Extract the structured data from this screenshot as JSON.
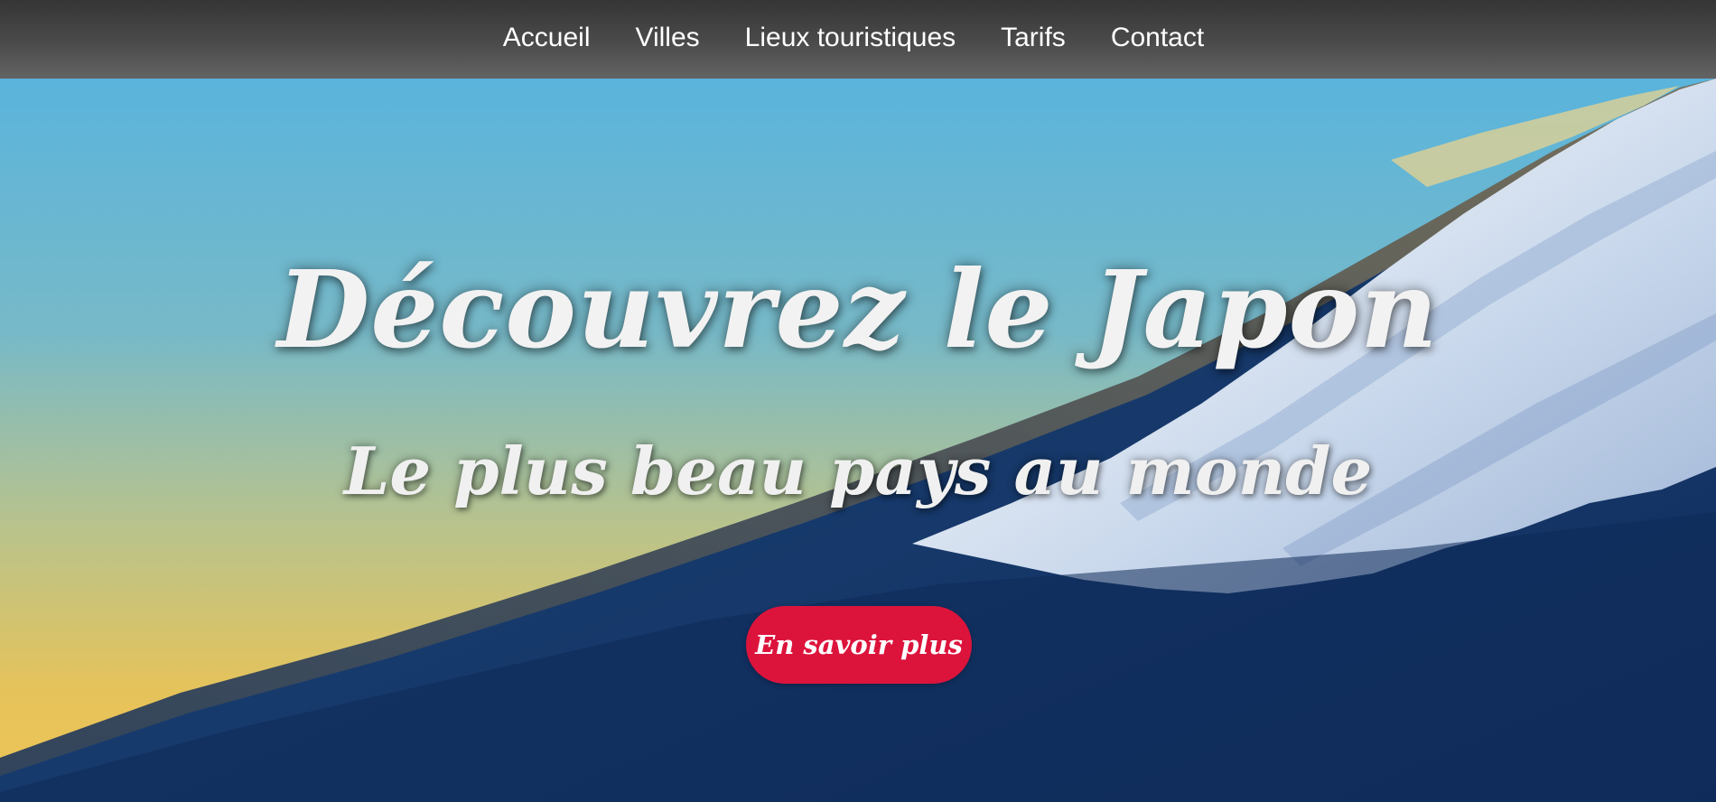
{
  "nav": {
    "items": [
      {
        "label": "Accueil"
      },
      {
        "label": "Villes"
      },
      {
        "label": "Lieux touristiques"
      },
      {
        "label": "Tarifs"
      },
      {
        "label": "Contact"
      }
    ]
  },
  "hero": {
    "title": "Découvrez le Japon",
    "subtitle": "Le plus beau pays au monde",
    "cta_label": "En savoir plus",
    "background_image": "mount-fuji-sunset"
  },
  "colors": {
    "nav_background": "#4b4b4b",
    "nav_text": "#ffffff",
    "cta_background": "#dc143c",
    "hero_text": "#f2f2f2",
    "sky_top": "#5fb7dc",
    "sky_bottom": "#e8c35a",
    "mountain": "#163a6e",
    "snow": "#e9eef5"
  }
}
